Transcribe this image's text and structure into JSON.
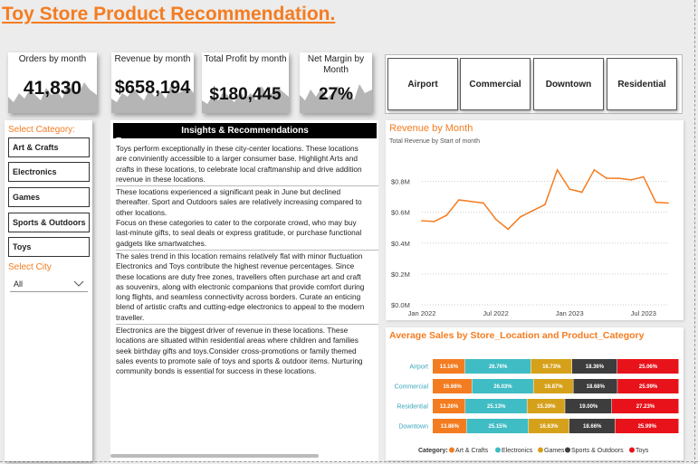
{
  "page_title": "Toy Store Product Recommendation.",
  "kpis": [
    {
      "label": "Orders by month",
      "value": "41,830"
    },
    {
      "label": "Revenue by month",
      "value": "$658,194"
    },
    {
      "label": "Total Profit by month",
      "value": "$180,445"
    },
    {
      "label": "Net Margin by Month",
      "value": "27%"
    }
  ],
  "locations": [
    "Airport",
    "Commercial",
    "Downtown",
    "Residential"
  ],
  "category_slicer": {
    "title": "Select Category:",
    "items": [
      "Art & Crafts",
      "Electronics",
      "Games",
      "Sports & Outdoors",
      "Toys"
    ]
  },
  "city_slicer": {
    "title": "Select City",
    "value": "All"
  },
  "insights": {
    "title": "Insights & Recommendations",
    "lines": [
      "Toys perform exceptionally in these city-center locations. These locations",
      "are conviniently accessible to a larger consumer base. Highlight Arts and",
      "crafts in these locations, to celebrate local craftmanship and drive addition",
      "revenue in these locations.",
      "These locations experienced a significant peak in June but declined",
      "thereafter. Sport and Outdoors sales are relatively increasing compared to",
      "other locations.",
      "Focus on these categories to cater to the corporate crowd, who may buy",
      "last-minute gifts, to seal deals or express gratitude, or purchase functional",
      "gadgets like smartwatches.",
      "The sales trend in this location remains relatively flat with minor fluctuation",
      "Electronics and Toys contribute the highest revenue percentages. Since",
      "these locations are duty free zones, travellers often purchase art and craft",
      "as souvenirs, along with electronic companions that provide comfort during",
      "long flights, and seamless connectivity across borders. Curate an enticing",
      "blend of artistic crafts and cutting-edge electronics to appeal to the modern",
      "traveller.",
      "Electronics are the biggest driver of revenue in these locations. These",
      "locations are situated within residential areas where children and families",
      "seek birthday gifts and toys.Consider cross-promotions or family themed",
      "sales events to promote sale of toys and sports & outdoor items. Nurturing",
      "community bonds is essential for success in these locations."
    ]
  },
  "colors": {
    "accent": "#f47c20",
    "art_crafts": "#f47c20",
    "electronics": "#3fbcc4",
    "games": "#d6a11a",
    "sports_outdoors": "#3d3d3d",
    "toys": "#e8121a"
  },
  "chart_data": [
    {
      "type": "line",
      "title": "Revenue by Month",
      "subtitle": "Total Revenue by Start of month",
      "x": [
        "2022-01",
        "2022-02",
        "2022-03",
        "2022-04",
        "2022-05",
        "2022-06",
        "2022-07",
        "2022-08",
        "2022-09",
        "2022-10",
        "2022-11",
        "2022-12",
        "2023-01",
        "2023-02",
        "2023-03",
        "2023-04",
        "2023-05",
        "2023-06",
        "2023-07",
        "2023-08",
        "2023-09"
      ],
      "y": [
        0.545,
        0.54,
        0.58,
        0.68,
        0.67,
        0.66,
        0.555,
        0.49,
        0.57,
        0.61,
        0.65,
        0.875,
        0.75,
        0.73,
        0.875,
        0.82,
        0.82,
        0.81,
        0.83,
        0.665,
        0.66
      ],
      "x_ticks": [
        "Jan 2022",
        "Jul 2022",
        "Jan 2023",
        "Jul 2023"
      ],
      "y_ticks": [
        "$0.0M",
        "$0.2M",
        "$0.4M",
        "$0.6M",
        "$0.8M"
      ],
      "ylim": [
        0,
        0.95
      ],
      "color": "#f47c20",
      "grid": true
    },
    {
      "type": "bar",
      "stacked": "100%",
      "title": "Average Sales by Store_Location and Product_Category",
      "categories": [
        "Airport",
        "Commercial",
        "Residential",
        "Downtown"
      ],
      "series": [
        {
          "name": "Art & Crafts",
          "values": [
            13.16,
            16.66,
            13.26,
            13.86
          ],
          "labels": [
            "13.16%",
            "16.66%",
            "13.26%",
            "13.86%"
          ]
        },
        {
          "name": "Electronics",
          "values": [
            26.76,
            26.03,
            25.13,
            25.15
          ],
          "labels": [
            "26.76%",
            "26.03%",
            "25.13%",
            "25.15%"
          ]
        },
        {
          "name": "Games",
          "values": [
            16.73,
            16.87,
            15.39,
            16.63
          ],
          "labels": [
            "16.73%",
            "16.87%",
            "15.39%",
            "16.63%"
          ]
        },
        {
          "name": "Sports & Outdoors",
          "values": [
            18.36,
            18.68,
            19.0,
            18.66
          ],
          "labels": [
            "18.36%",
            "18.68%",
            "19.00%",
            "18.66%"
          ]
        },
        {
          "name": "Toys",
          "values": [
            25.06,
            25.99,
            27.23,
            25.99
          ],
          "labels": [
            "25.06%",
            "25.99%",
            "27.23%",
            "25.99%"
          ]
        }
      ],
      "legend_title": "Category:",
      "legend_position": "bottom"
    }
  ]
}
